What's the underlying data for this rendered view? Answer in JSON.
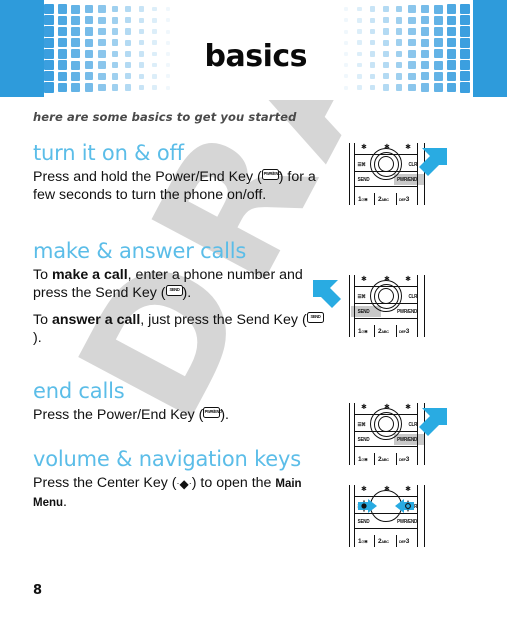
{
  "page": {
    "number": "8",
    "watermark": "DRAFT"
  },
  "header": {
    "title": "basics",
    "banner_color": "#2e9bdb",
    "pattern_color": "#3b9fdf"
  },
  "intro": "here are some basics to get you started",
  "theme": {
    "heading_color": "#5bbde8",
    "body_color": "#111111",
    "callout_arrow_color": "#29abe2",
    "key_highlight_color": "#c9c9c9"
  },
  "sections": [
    {
      "heading": "turn it on & off",
      "paragraphs": [
        {
          "parts": [
            {
              "type": "text",
              "value": "Press and hold the Power/End Key ("
            },
            {
              "type": "key",
              "value": "PWR/END"
            },
            {
              "type": "text",
              "value": ") for a few seconds to turn the phone on/off."
            }
          ]
        }
      ],
      "illustration": {
        "highlight": "PWR/END",
        "arrow": "right-of-end-key",
        "arrow_direction": "down-left"
      }
    },
    {
      "heading": "make & answer calls",
      "paragraphs": [
        {
          "parts": [
            {
              "type": "text",
              "value": "To "
            },
            {
              "type": "bold",
              "value": "make a call"
            },
            {
              "type": "text",
              "value": ", enter a phone number and press the Send Key ("
            },
            {
              "type": "key",
              "value": "SEND"
            },
            {
              "type": "text",
              "value": ")."
            }
          ]
        },
        {
          "parts": [
            {
              "type": "text",
              "value": "To "
            },
            {
              "type": "bold",
              "value": "answer a call"
            },
            {
              "type": "text",
              "value": ", just press the Send Key ("
            },
            {
              "type": "key",
              "value": "SEND"
            },
            {
              "type": "text",
              "value": ")."
            }
          ]
        }
      ],
      "illustration": {
        "highlight": "SEND",
        "arrow": "left-of-send-key",
        "arrow_direction": "down-right"
      }
    },
    {
      "heading": "end calls",
      "paragraphs": [
        {
          "parts": [
            {
              "type": "text",
              "value": "Press the Power/End Key ("
            },
            {
              "type": "key",
              "value": "PWR/END"
            },
            {
              "type": "text",
              "value": ")."
            }
          ]
        }
      ],
      "illustration": {
        "highlight": "PWR/END",
        "arrow": "right-of-end-key",
        "arrow_direction": "down-left"
      }
    },
    {
      "heading": "volume & navigation keys",
      "paragraphs": [
        {
          "parts": [
            {
              "type": "text",
              "value": "Press the Center Key ("
            },
            {
              "type": "centerkey",
              "value": "center-key"
            },
            {
              "type": "text",
              "value": ") to open the "
            },
            {
              "type": "smallcaps",
              "value": "Main Menu"
            },
            {
              "type": "text",
              "value": "."
            }
          ]
        }
      ],
      "illustration": {
        "highlight": "none",
        "arrow": "both-sides-of-nav-ring",
        "arrow_direction": "inward"
      }
    }
  ],
  "keypad": {
    "star_marks": [
      "✱",
      "✱",
      "✱"
    ],
    "left_softkey": "☰⌘",
    "right_softkey": "CLR",
    "send_label": "SEND",
    "end_label": "PWR/END",
    "numbers": [
      {
        "digit": "1",
        "letters": "☉✱"
      },
      {
        "digit": "2",
        "letters": "ABC"
      },
      {
        "digit": "3",
        "letters": "DEF"
      }
    ]
  }
}
